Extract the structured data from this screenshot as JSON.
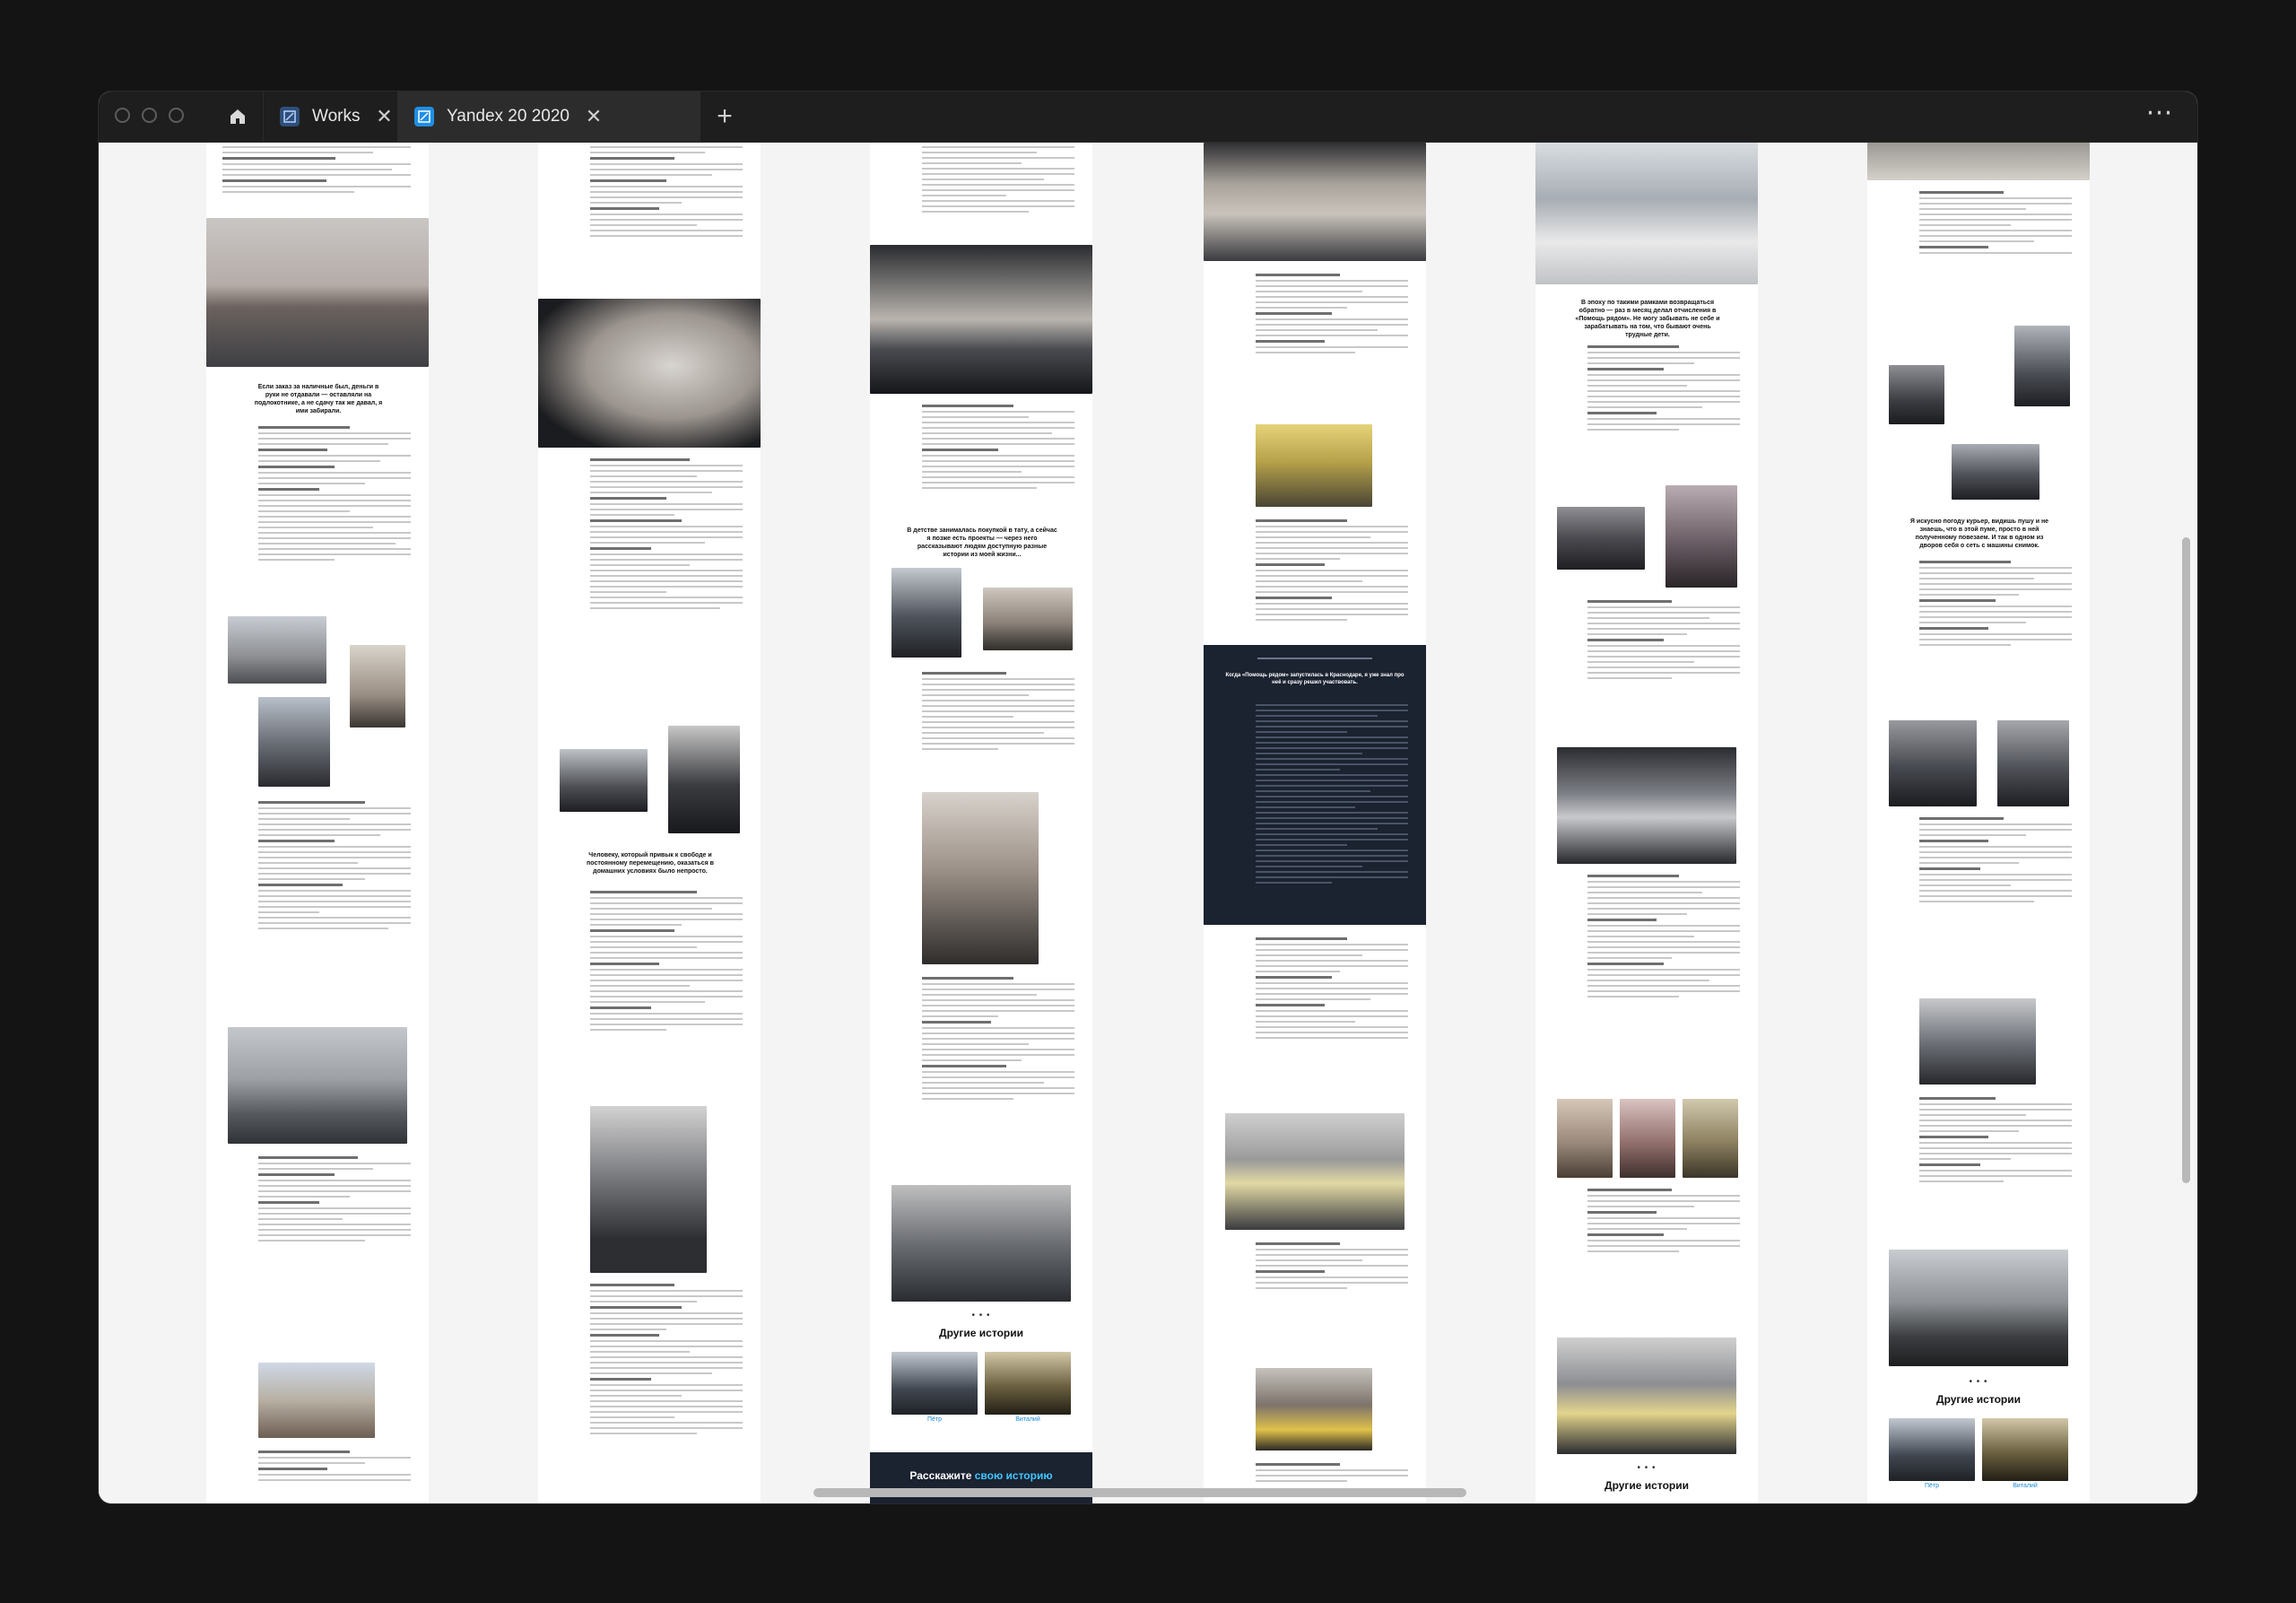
{
  "browser": {
    "tabs": [
      {
        "label": "Works",
        "active": false,
        "icon": "figma-file-icon"
      },
      {
        "label": "Yandex 20 2020",
        "active": true,
        "icon": "figma-file-icon"
      }
    ],
    "new_tab_label": "+",
    "menu_label": "⋯"
  },
  "pages": {
    "p1": {
      "quote": "Если заказ за наличные был, деньги в руки не отдавали — оставляли на подлокотнике, а не сдачу так же давал, я ими забирали."
    },
    "p2": {
      "quote": "Человеку, который привык к свободе и постоянному перемещению, оказаться в домашних условиях было непросто."
    },
    "p3": {
      "quote": "В детстве занималась покупкой в тату, а сейчас я позже есть проекты — через него рассказывают людям доступную разные истории из моей жизни...",
      "other_title": "Другие истории",
      "captions": [
        "Пётр",
        "Виталий"
      ],
      "cta_white": "Расскажите ",
      "cta_accent": "свою историю"
    },
    "p4": {
      "dark_title": "Когда «Помощь рядом» запустилась в Краснодаре, я уже знал про неё и сразу решил участвовать."
    },
    "p5": {
      "quote": "В эпоху по такими рамками возвращаться обратно — раз в месяц делал отчисления в «Помощь рядом». Не могу забывать не себе и зарабатывать на том, что бывают очень трудные дети.",
      "other_title": "Другие истории"
    },
    "p6": {
      "quote": "Я искусно погоду курьер, видишь пушу и не знаешь, что в этой пуме, просто в ней полученному повезаем. И так в одном из дворов себя о сеть с машины снимок.",
      "other_title": "Другие истории",
      "captions": [
        "Пётр",
        "Виталий"
      ]
    }
  }
}
